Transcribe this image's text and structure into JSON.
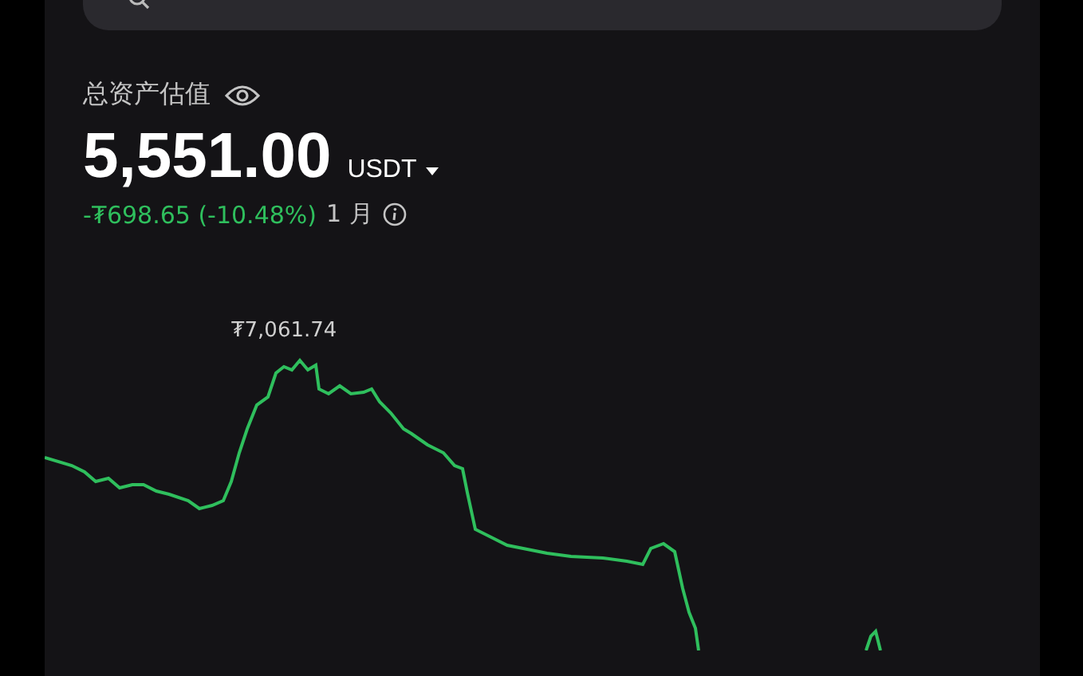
{
  "total_assets": {
    "label": "总资产估值",
    "amount": "5,551.00",
    "currency": "USDT",
    "change": "-₮698.65 (-10.48%)",
    "period": "1 月"
  },
  "chart": {
    "peak_label": "₮7,061.74"
  }
}
